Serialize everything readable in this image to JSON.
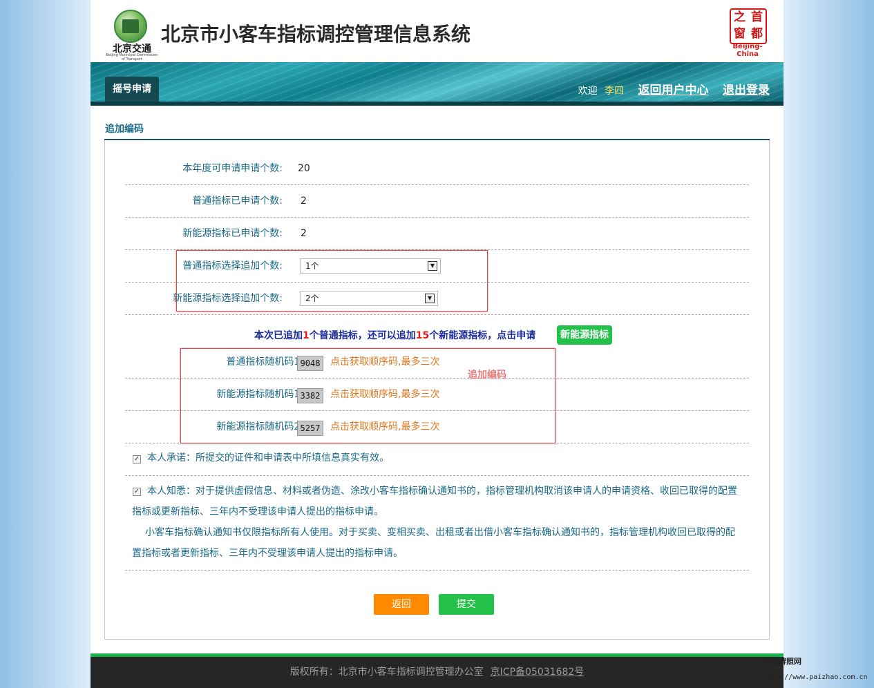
{
  "header": {
    "logo_text": "北京交通",
    "logo_sub": "Beijing Municipal Commission of Transport",
    "title": "北京市小客车指标调控管理信息系统",
    "seal_chars": [
      "之",
      "首",
      "窗",
      "都"
    ],
    "seal_caption": "Beijing-China"
  },
  "nav": {
    "active_tab": "摇号申请",
    "welcome": "欢迎",
    "user": "李四",
    "user_center": "返回用户中心",
    "logout": "退出登录"
  },
  "section": {
    "title": "追加编码"
  },
  "form": {
    "annual_label": "本年度可申请申请个数:",
    "annual_value": "20",
    "normal_applied_label": "普通指标已申请个数:",
    "normal_applied_value": "2",
    "ev_applied_label": "新能源指标已申请个数:",
    "ev_applied_value": "2",
    "normal_add_label": "普通指标选择追加个数:",
    "normal_add_value": "1个",
    "ev_add_label": "新能源指标选择追加个数:",
    "ev_add_value": "2个"
  },
  "notice": {
    "p1": "本次已追加",
    "n1": "1",
    "p2": "个普通指标，还可以追加",
    "n2": "15",
    "p3": "个新能源指标，点击申请",
    "button": "新能源指标"
  },
  "codes": [
    {
      "label": "普通指标随机码1:",
      "code": "9048",
      "link": "点击获取顺序码,最多三次"
    },
    {
      "label": "新能源指标随机码1:",
      "code": "3382",
      "link": "点击获取顺序码,最多三次"
    },
    {
      "label": "新能源指标随机码2:",
      "code": "5257",
      "link": "点击获取顺序码,最多三次"
    }
  ],
  "annotation": "追加编码",
  "pledge": "本人承诺：所提交的证件和申请表中所填信息真实有效。",
  "aware_1": "本人知悉：对于提供虚假信息、材料或者伪造、涂改小客车指标确认通知书的，指标管理机构取消该申请人的申请资格、收回已取得的配置",
  "aware_2": "指标或更新指标、三年内不受理该申请人提出的指标申请。",
  "aware_3": "小客车指标确认通知书仅限指标所有人使用。对于买卖、变相买卖、出租或者出借小客车指标确认通知书的，指标管理机构收回已取得的配",
  "aware_4": "置指标或者更新指标、三年内不受理该申请人提出的指标申请。",
  "buttons": {
    "back": "返回",
    "submit": "提交"
  },
  "footer": {
    "copyright": "版权所有：北京市小客车指标调控管理办公室",
    "icp": "京ICP备05031682号"
  },
  "watermark": {
    "line1": "中国牌照网",
    "line2": "http://www.paizhao.com.cn"
  }
}
